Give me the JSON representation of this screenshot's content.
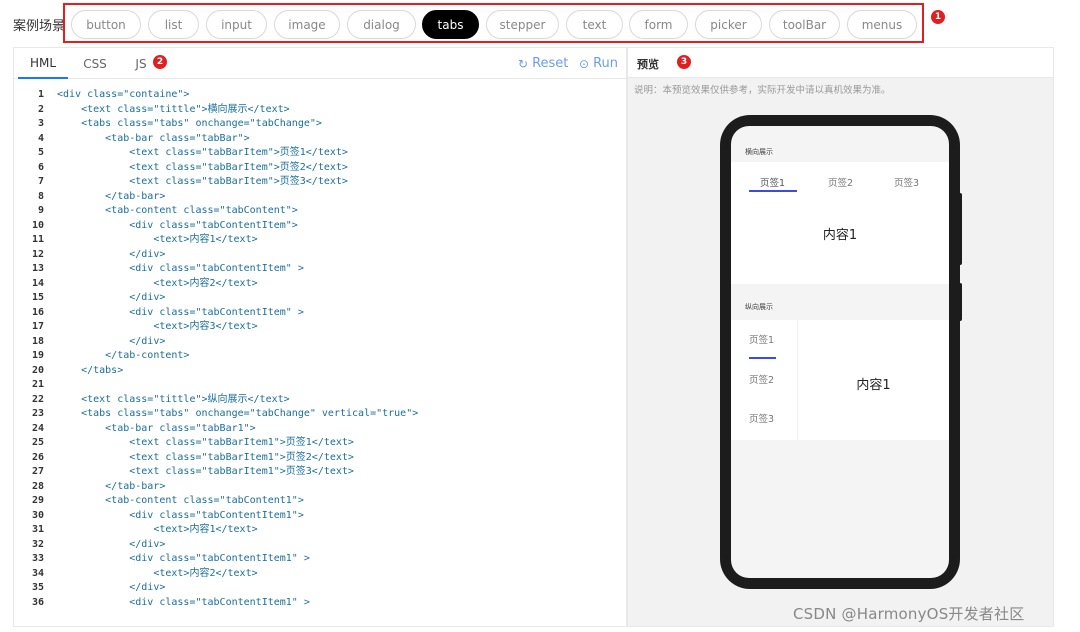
{
  "topbar": {
    "scene_label": "案例场景",
    "scenes": [
      {
        "label": "button",
        "active": false
      },
      {
        "label": "list",
        "active": false
      },
      {
        "label": "input",
        "active": false
      },
      {
        "label": "image",
        "active": false
      },
      {
        "label": "dialog",
        "active": false
      },
      {
        "label": "tabs",
        "active": true
      },
      {
        "label": "stepper",
        "active": false
      },
      {
        "label": "text",
        "active": false
      },
      {
        "label": "form",
        "active": false
      },
      {
        "label": "picker",
        "active": false
      },
      {
        "label": "toolBar",
        "active": false
      },
      {
        "label": "menus",
        "active": false
      }
    ],
    "marker": "1"
  },
  "editor": {
    "tabs": [
      {
        "label": "HML",
        "active": true
      },
      {
        "label": "CSS",
        "active": false
      },
      {
        "label": "JS",
        "active": false
      }
    ],
    "marker": "2",
    "reset_label": "Reset",
    "run_label": "Run",
    "lines": [
      "<div class=\"containe\">",
      "    <text class=\"tittle\">横向展示</text>",
      "    <tabs class=\"tabs\" onchange=\"tabChange\">",
      "        <tab-bar class=\"tabBar\">",
      "            <text class=\"tabBarItem\">页签1</text>",
      "            <text class=\"tabBarItem\">页签2</text>",
      "            <text class=\"tabBarItem\">页签3</text>",
      "        </tab-bar>",
      "        <tab-content class=\"tabContent\">",
      "            <div class=\"tabContentItem\">",
      "                <text>内容1</text>",
      "            </div>",
      "            <div class=\"tabContentItem\" >",
      "                <text>内容2</text>",
      "            </div>",
      "            <div class=\"tabContentItem\" >",
      "                <text>内容3</text>",
      "            </div>",
      "        </tab-content>",
      "    </tabs>",
      "",
      "    <text class=\"tittle\">纵向展示</text>",
      "    <tabs class=\"tabs\" onchange=\"tabChange\" vertical=\"true\">",
      "        <tab-bar class=\"tabBar1\">",
      "            <text class=\"tabBarItem1\">页签1</text>",
      "            <text class=\"tabBarItem1\">页签2</text>",
      "            <text class=\"tabBarItem1\">页签3</text>",
      "        </tab-bar>",
      "        <tab-content class=\"tabContent1\">",
      "            <div class=\"tabContentItem1\">",
      "                <text>内容1</text>",
      "            </div>",
      "            <div class=\"tabContentItem1\" >",
      "                <text>内容2</text>",
      "            </div>",
      "            <div class=\"tabContentItem1\" >"
    ]
  },
  "preview": {
    "title": "预览",
    "marker": "3",
    "note": "说明：本预览效果仅供参考，实际开发中请以真机效果为准。",
    "phone": {
      "horizontal_title": "横向展示",
      "horizontal_tabs": [
        "页签1",
        "页签2",
        "页签3"
      ],
      "horizontal_content": "内容1",
      "vertical_title": "纵向展示",
      "vertical_tabs": [
        "页签1",
        "页签2",
        "页签3"
      ],
      "vertical_content": "内容1"
    }
  },
  "watermark": "CSDN @HarmonyOS开发者社区",
  "colors": {
    "accent": "#3a4de0",
    "highlight_border": "#e02020",
    "tool_button": "#6a9ee8"
  }
}
